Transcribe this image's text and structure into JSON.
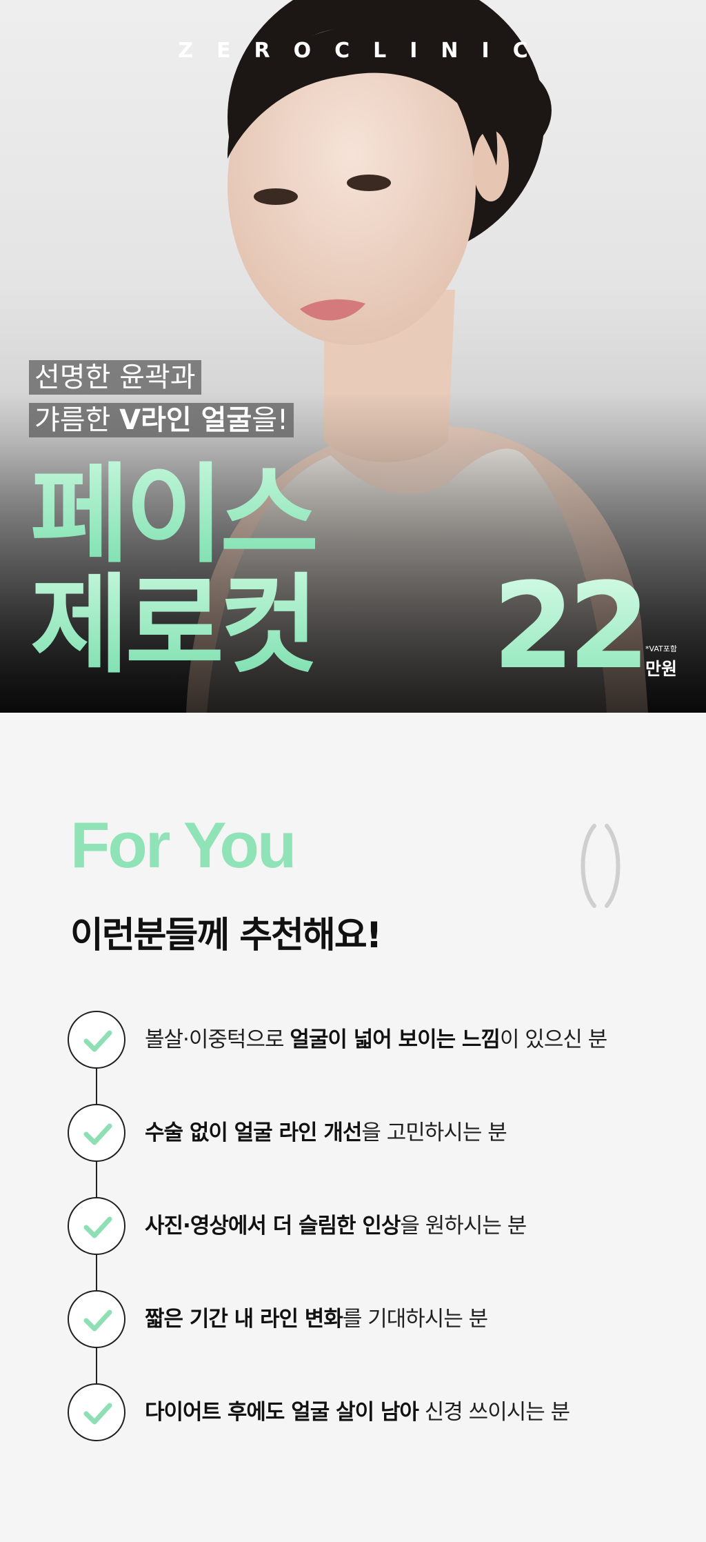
{
  "hero": {
    "brand": "ZEROCLINIC",
    "tagline_1": "선명한 윤곽과",
    "tagline_2_prefix": "갸름한 ",
    "tagline_2_bold": "V라인 얼굴",
    "tagline_2_suffix": "을!",
    "title_line_1": "페이스",
    "title_line_2": "제로컷",
    "price": "22",
    "vat_note": "*VAT포함",
    "price_unit": "만원"
  },
  "for_you": {
    "title": "For You",
    "subtitle": "이런분들께 추천해요!",
    "items": [
      {
        "pre": "볼살·이중턱으로 ",
        "bold": "얼굴이 넓어 보이는 느낌",
        "post": "이 있으신 분"
      },
      {
        "pre": "",
        "bold": "수술 없이 얼굴 라인 개선",
        "post": "을 고민하시는 분"
      },
      {
        "pre": "",
        "bold": "사진·영상에서 더 슬림한 인상",
        "post": "을 원하시는 분"
      },
      {
        "pre": "",
        "bold": "짧은 기간 내 라인 변화",
        "post": "를 기대하시는 분"
      },
      {
        "pre": "",
        "bold": "다이어트 후에도 얼굴 살이 남아",
        "post": " 신경 쓰이시는 분"
      }
    ]
  },
  "colors": {
    "accent_mint": "#8fe3b6",
    "check_mark": "#8ee0b4",
    "text_dark": "#111111"
  },
  "icons": {
    "check": "check-icon"
  }
}
